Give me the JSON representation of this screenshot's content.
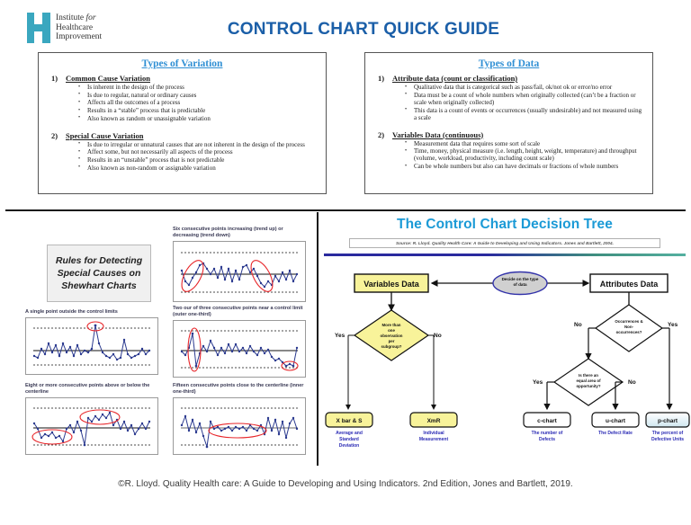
{
  "header": {
    "logo_lines": [
      "Institute for",
      "Healthcare",
      "Improvement"
    ],
    "logo_line1_normal": "Institute ",
    "logo_line1_italic": "for",
    "title": "CONTROL CHART QUICK GUIDE",
    "brand_color": "#3aa7bf",
    "title_color": "#1b5fa8"
  },
  "panels": [
    {
      "title": "Types of Variation",
      "sections": [
        {
          "number": "1)",
          "heading": "Common Cause Variation",
          "bullets": [
            "Is inherent in the design of the process",
            "Is due to regular, natural or ordinary causes",
            "Affects all the outcomes of a process",
            "Results in a “stable” process that is predictable",
            "Also known as random or unassignable variation"
          ]
        },
        {
          "number": "2)",
          "heading": "Special Cause Variation",
          "bullets": [
            "Is due to irregular or unnatural causes that are not inherent in the design of the process",
            "Affect some, but not necessarily all aspects of the process",
            "Results in an “unstable” process that is not predictable",
            "Also known as non-random or assignable variation"
          ]
        }
      ]
    },
    {
      "title": "Types of Data",
      "sections": [
        {
          "number": "1)",
          "heading": "Attribute data (count or classification)",
          "bullets": [
            "Qualitative data that is categorical such as pass/fail, ok/not ok or error/no error",
            "Data must be a count of whole numbers when originally collected (can’t be a fraction or scale when originally collected)",
            "This data is a count of events or occurrences (usually undesirable) and not measured using a scale"
          ]
        },
        {
          "number": "2)",
          "heading": "Variables Data (continuous)",
          "bullets": [
            "Measurement data that requires some sort of scale",
            "Time, money, physical measure (i.e. length, height, weight, temperature) and throughput (volume, workload, productivity, including count scale)",
            "Can be whole numbers but also can have decimals or fractions of whole numbers"
          ]
        }
      ]
    }
  ],
  "rules": {
    "box_title": "Rules for Detecting Special Causes on Shewhart Charts",
    "charts": [
      {
        "caption": "Six consecutive points increasing (trend up) or decreasing (trend down)"
      },
      {
        "caption": "A single point outside the control limits"
      },
      {
        "caption": "Two our of three consecutive points near a control limit (outer one-third)"
      },
      {
        "caption": "Eight or more consecutive points above or below the centerline"
      },
      {
        "caption": "Fifteen consecutive points close to the centerline (inner one-third)"
      }
    ]
  },
  "tree": {
    "title": "The Control Chart Decision Tree",
    "source": "Source: R. Lloyd. Quality Health Care: A Guide to Developing and Using Indicators. Jones and Bartlett, 2004.",
    "start_label": "Decide on the type of data",
    "variables_label": "Variables Data",
    "attributes_label": "Attributes Data",
    "diamond_variables": "More than one observation per subgroup?",
    "diamond_attributes": "Occurrences & Non-occurrences?",
    "diamond_opportunity": "Is there an equal area of opportunity?",
    "edge_yes": "Yes",
    "edge_no": "No",
    "outcomes": [
      {
        "chart": "X bar & S",
        "desc": "Average and Standard Deviation",
        "fill": "#f8f39a"
      },
      {
        "chart": "XmR",
        "desc": "Individual Measurement",
        "fill": "#f8f39a"
      },
      {
        "chart": "c-chart",
        "desc": "The number of Defects",
        "fill": "#ffffff"
      },
      {
        "chart": "u-chart",
        "desc": "The Defect Rate",
        "fill": "#ffffff"
      },
      {
        "chart": "p-chart",
        "desc": "The percent of Defective Units",
        "fill": "#e8f4f8"
      }
    ]
  },
  "footer": {
    "citation": "©R. Lloyd. Quality Health care: A Guide to Developing and Using Indicators. 2nd Edition, Jones and Bartlett, 2019."
  }
}
